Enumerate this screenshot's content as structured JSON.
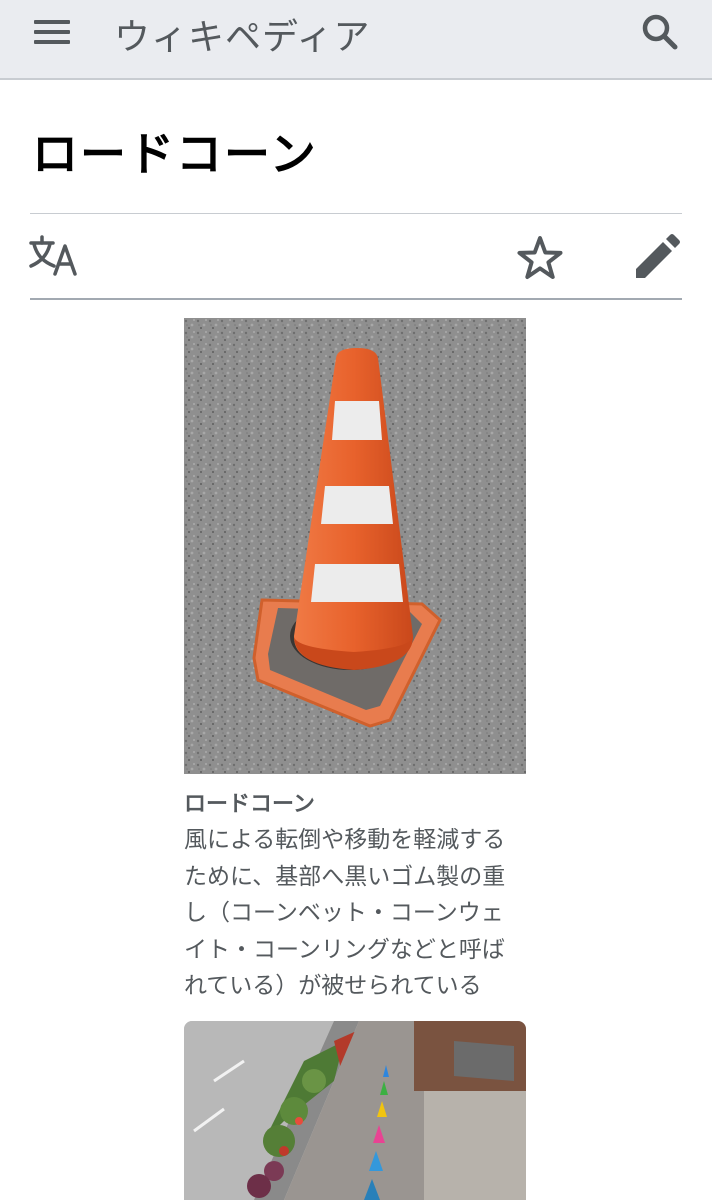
{
  "header": {
    "site_name": "ウィキペディア",
    "menu_icon": "hamburger-menu-icon",
    "search_icon": "search-icon"
  },
  "page": {
    "title": "ロードコーン"
  },
  "actions": {
    "language_icon": "language-icon",
    "watch_icon": "star-icon",
    "edit_icon": "pencil-icon"
  },
  "figures": [
    {
      "caption_title": "ロードコーン",
      "caption_lines": [
        "風による転倒や移動を軽減する",
        "ために、基部へ黒いゴム製の重",
        "し（コーンベット・コーンウェ",
        "イト・コーンリングなどと呼ば",
        "れている）が被せられている"
      ]
    }
  ],
  "colors": {
    "header_bg": "#eaecf0",
    "icon_gray": "#54595d",
    "cone_orange": "#e8622c"
  }
}
